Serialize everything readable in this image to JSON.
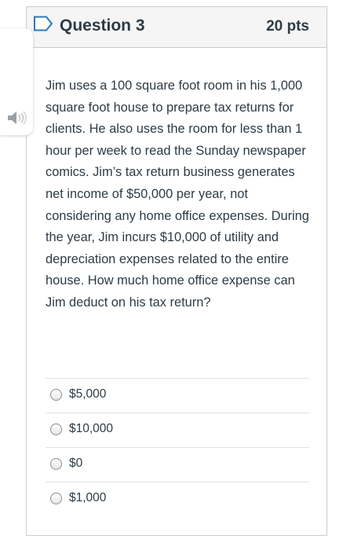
{
  "question": {
    "title": "Question 3",
    "points": "20 pts",
    "body": "Jim uses a 100 square foot room in his 1,000 square foot house to prepare tax returns for clients.  He also uses the room for less than 1 hour per week to read the Sunday newspaper comics.  Jim’s tax return business generates net income of $50,000 per year, not considering any home office expenses.  During the year, Jim incurs $10,000 of utility and depreciation expenses related to the entire house.  How much home office expense can Jim deduct on his tax return?"
  },
  "answers": [
    {
      "label": "$5,000"
    },
    {
      "label": "$10,000"
    },
    {
      "label": "$0"
    },
    {
      "label": "$1,000"
    }
  ],
  "icons": {
    "flag": "flag-outline-icon",
    "speaker": "speaker-icon"
  },
  "colors": {
    "accent": "#2b7abc",
    "text": "#2d3b45",
    "header_bg": "#f5f5f5",
    "border": "#c7cdd1"
  }
}
